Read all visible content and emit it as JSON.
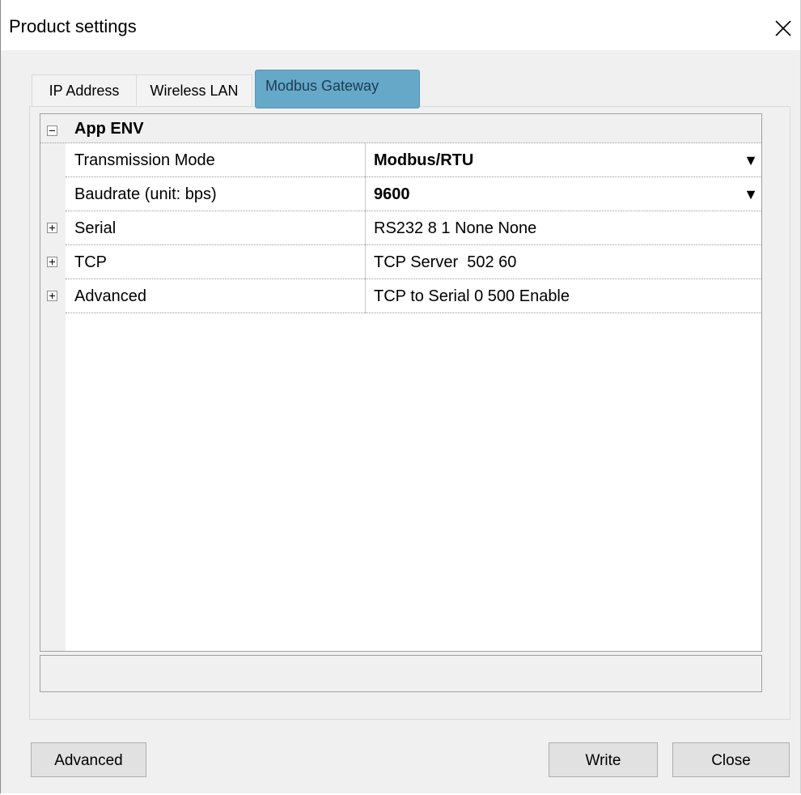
{
  "window": {
    "title": "Product settings",
    "close_icon": "close-icon"
  },
  "tabs": [
    {
      "label": "IP Address",
      "selected": false
    },
    {
      "label": "Wireless LAN",
      "selected": false
    },
    {
      "label": "Modbus Gateway",
      "selected": true
    }
  ],
  "property_grid": {
    "category": {
      "label": "App ENV",
      "expanded": true,
      "expander_icon": "collapse-minus-icon"
    },
    "rows": [
      {
        "name": "Transmission Mode",
        "value": "Modbus/RTU",
        "bold_value": true,
        "dropdown": true,
        "dropdown_icon": "dropdown-triangle-icon"
      },
      {
        "name": "Baudrate (unit: bps)",
        "value": "9600",
        "bold_value": true,
        "dropdown": true,
        "dropdown_icon": "dropdown-triangle-icon"
      },
      {
        "name": "Serial",
        "value": "RS232 8 1 None None",
        "expandable": true,
        "expander_icon": "expand-plus-icon"
      },
      {
        "name": "TCP",
        "value": "TCP Server  502 60",
        "expandable": true,
        "expander_icon": "expand-plus-icon"
      },
      {
        "name": "Advanced",
        "value": "TCP to Serial 0 500 Enable",
        "expandable": true,
        "expander_icon": "expand-plus-icon"
      }
    ],
    "dropdown_glyph": "▼"
  },
  "description_panel": {
    "text": ""
  },
  "buttons": {
    "advanced": "Advanced",
    "write": "Write",
    "close": "Close"
  },
  "colors": {
    "selected_tab_bg": "#66a8c8",
    "dialog_bg": "#f0f0f0",
    "grid_bg": "#ffffff",
    "button_bg": "#e1e1e1"
  }
}
